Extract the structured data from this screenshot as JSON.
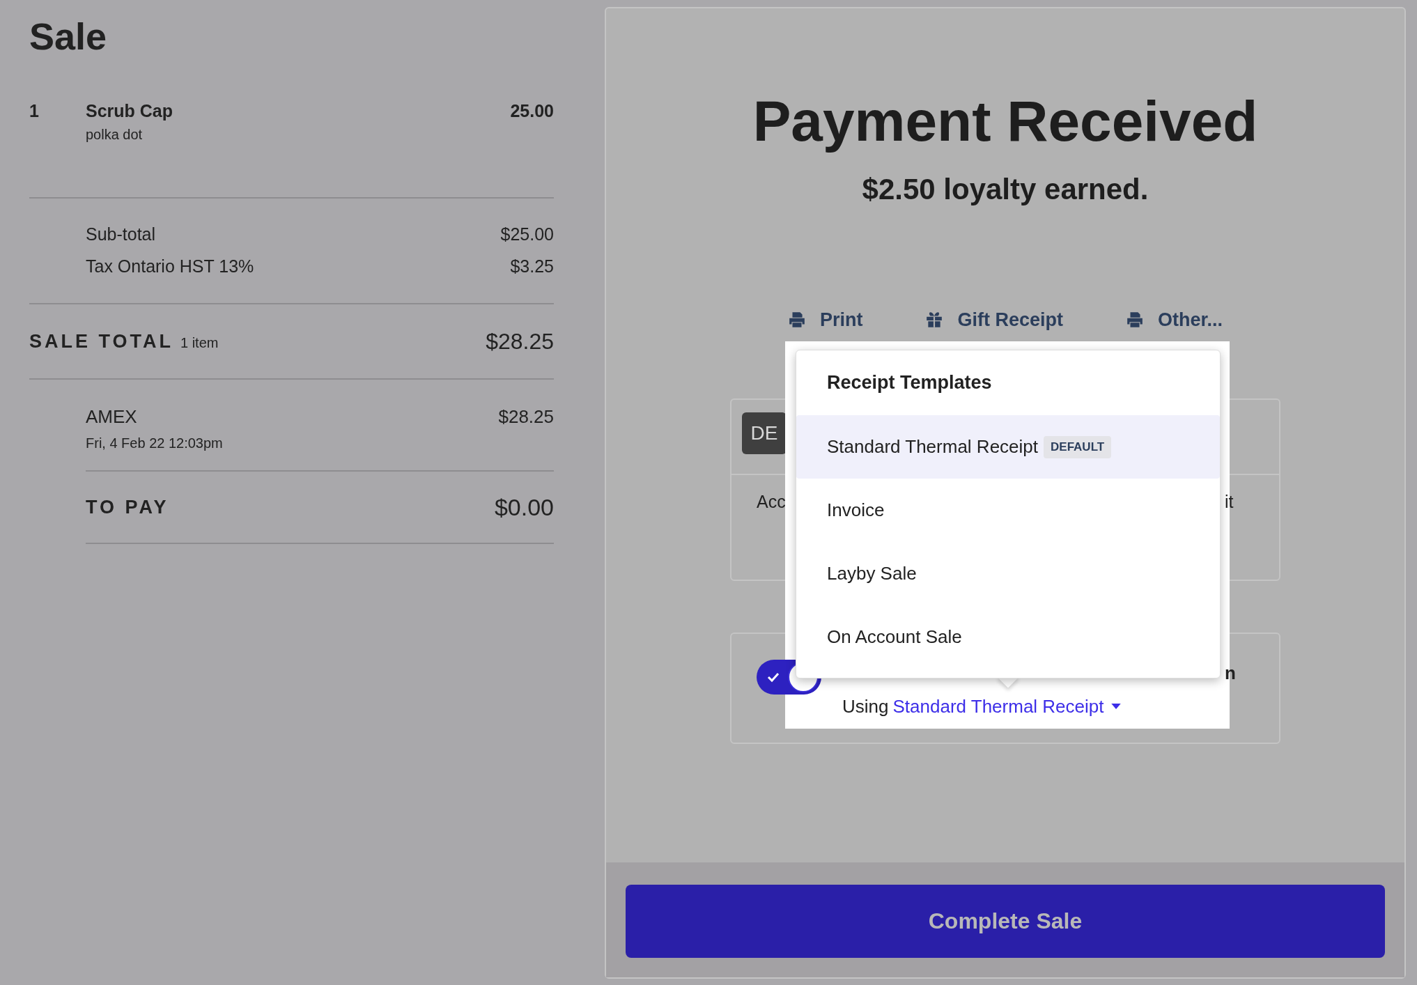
{
  "sale": {
    "title": "Sale",
    "items": [
      {
        "qty": "1",
        "name": "Scrub Cap",
        "variant": "polka dot",
        "price": "25.00"
      }
    ],
    "subtotals": [
      {
        "label": "Sub-total",
        "amount": "$25.00"
      },
      {
        "label": "Tax Ontario HST 13%",
        "amount": "$3.25"
      }
    ],
    "total": {
      "label": "SALE TOTAL",
      "count": "1 item",
      "amount": "$28.25"
    },
    "payments": [
      {
        "method": "AMEX",
        "date": "Fri, 4 Feb 22 12:03pm",
        "amount": "$28.25"
      }
    ],
    "to_pay": {
      "label": "TO PAY",
      "amount": "$0.00"
    }
  },
  "payment": {
    "title": "Payment Received",
    "loyalty": "$2.50 loyalty earned.",
    "actions": [
      {
        "kind": "print",
        "label": "Print"
      },
      {
        "kind": "gift",
        "label": "Gift Receipt"
      },
      {
        "kind": "print",
        "label": "Other..."
      }
    ],
    "customer_card": {
      "avatar": "DE",
      "left_text": "Acc",
      "right_text": "it"
    },
    "email_card": {
      "toggle_on": true,
      "label_end": "n",
      "using": "Using",
      "template": "Standard Thermal Receipt"
    },
    "complete_button": "Complete Sale"
  },
  "template_menu": {
    "heading": "Receipt Templates",
    "items": [
      {
        "label": "Standard Thermal Receipt",
        "badge": "DEFAULT",
        "selected": true
      },
      {
        "label": "Invoice",
        "selected": false
      },
      {
        "label": "Layby Sale",
        "selected": false
      },
      {
        "label": "On Account Sale",
        "selected": false
      }
    ]
  }
}
